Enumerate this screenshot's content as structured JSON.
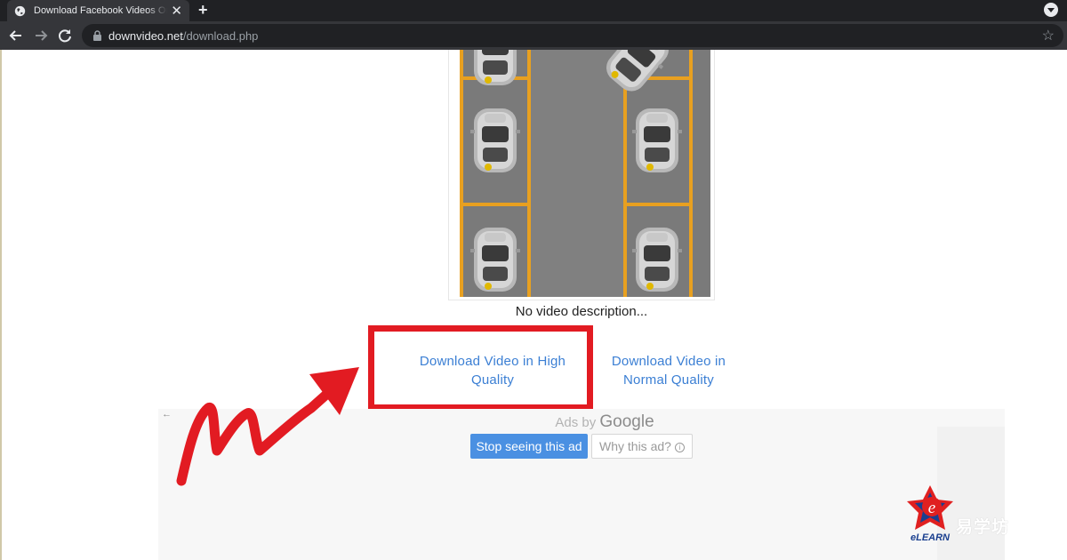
{
  "browser": {
    "tab_title": "Download Facebook Videos Online",
    "tab_close": "✕",
    "new_tab": "+",
    "url_host": "downvideo.net",
    "url_path": "/download.php",
    "star": "☆"
  },
  "page": {
    "video_description": "No video description...",
    "download_high_label": "Download Video in High Quality",
    "download_normal_label": "Download Video in Normal Quality"
  },
  "ad": {
    "back_arrow": "←",
    "ads_by_prefix": "Ads by",
    "ads_by_brand": "Google",
    "stop_button": "Stop seeing this ad",
    "why_button": "Why this ad?",
    "info_glyph": "i"
  },
  "watermark": {
    "logo_letter": "e",
    "logo_word": "eLEARN",
    "side_text": "易学坊"
  },
  "colors": {
    "highlight": "#e21b22",
    "link": "#3b7fd4",
    "primary_button": "#4a90e2"
  }
}
